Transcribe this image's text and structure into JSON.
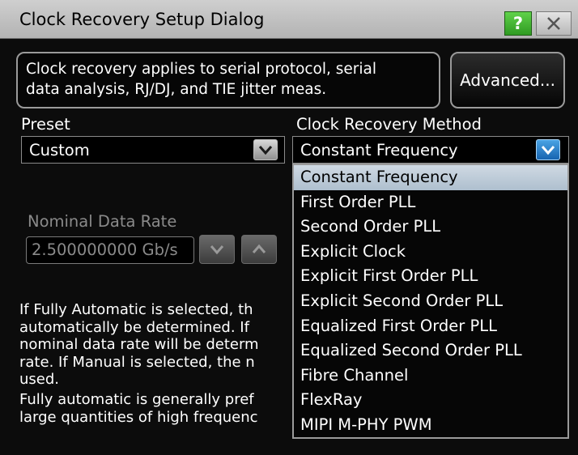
{
  "window": {
    "title": "Clock Recovery Setup Dialog",
    "help_label": "?"
  },
  "info": {
    "lines": [
      "Clock recovery applies to serial protocol, serial",
      "data analysis, RJ/DJ, and TIE jitter meas."
    ]
  },
  "advanced_button": "Advanced...",
  "preset": {
    "label": "Preset",
    "value": "Custom"
  },
  "method": {
    "label": "Clock Recovery Method",
    "value": "Constant Frequency",
    "options": [
      "Constant Frequency",
      "First Order PLL",
      "Second Order PLL",
      "Explicit Clock",
      "Explicit First Order PLL",
      "Explicit Second Order PLL",
      "Equalized First Order PLL",
      "Equalized Second Order PLL",
      "Fibre Channel",
      "FlexRay",
      "MIPI M-PHY PWM"
    ],
    "selected_index": 0
  },
  "data_rate": {
    "label": "Nominal Data Rate",
    "value": "2.500000000 Gb/s"
  },
  "help_text": {
    "para1": [
      "If Fully Automatic is selected, th",
      "automatically be determined. If ",
      "nominal data rate will be determ",
      "rate. If Manual is selected, the n",
      "used."
    ],
    "para2": [
      "Fully automatic is generally pref",
      "large quantities of high frequenc"
    ]
  },
  "colors": {
    "selection": "#b8c8d6",
    "accent_blue": "#1f6fbf",
    "help_green": "#3aa52a"
  }
}
